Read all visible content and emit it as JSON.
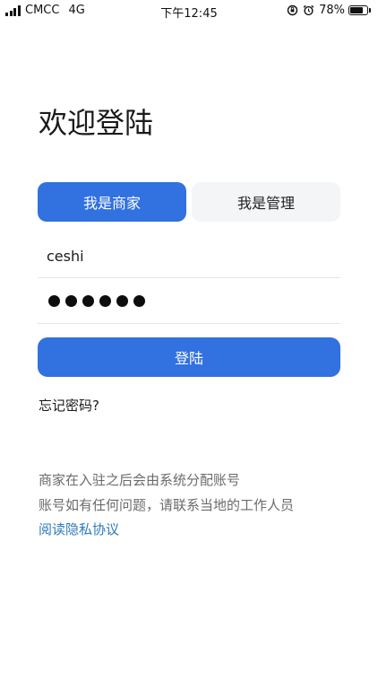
{
  "status_bar": {
    "carrier": "CMCC",
    "network": "4G",
    "time": "下午12:45",
    "battery_text": "78%",
    "battery_level": 0.78,
    "icons": [
      "signal-icon",
      "rotation-lock-icon",
      "alarm-icon",
      "battery-icon"
    ]
  },
  "page": {
    "title": "欢迎登陆"
  },
  "roles": {
    "merchant_label": "我是商家",
    "admin_label": "我是管理",
    "selected": "merchant"
  },
  "form": {
    "username_value": "ceshi",
    "password_length": 6,
    "login_label": "登陆",
    "forgot_label": "忘记密码?"
  },
  "notice": {
    "line1": "商家在入驻之后会由系统分配账号",
    "line2": "账号如有任何问题，请联系当地的工作人员",
    "privacy_link": "阅读隐私协议"
  },
  "colors": {
    "primary": "#3171e0",
    "tab_inactive_bg": "#f4f5f7",
    "link": "#2d7bb8",
    "muted_text": "#6b6b6b"
  }
}
